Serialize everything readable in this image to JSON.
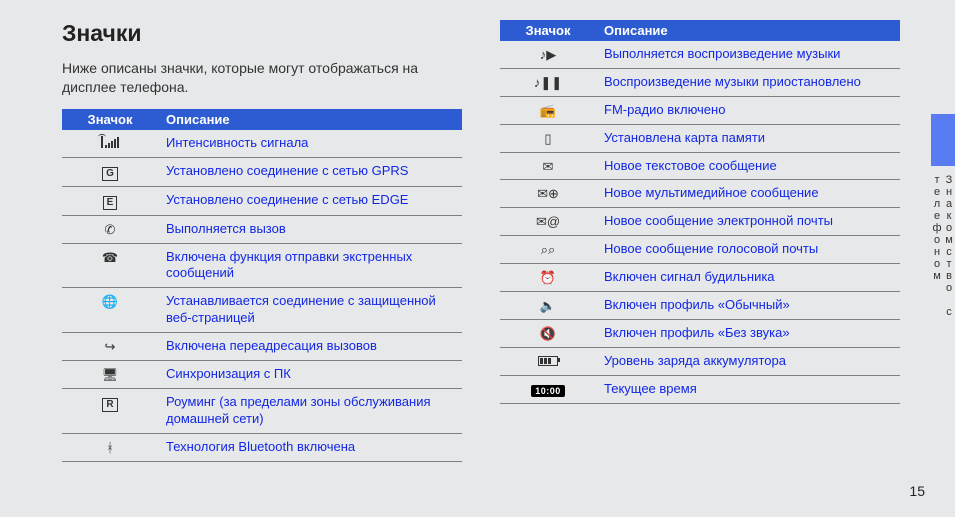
{
  "heading": "Значки",
  "intro": "Ниже описаны значки, которые могут отображаться на дисплее телефона.",
  "headers": {
    "icon": "Значок",
    "desc": "Описание"
  },
  "left_rows": [
    {
      "icon_name": "signal-strength-icon",
      "glyph": "signal",
      "desc": "Интенсивность сигнала"
    },
    {
      "icon_name": "gprs-icon",
      "glyph": "|G|",
      "desc": "Установлено соединение с сетью GPRS"
    },
    {
      "icon_name": "edge-icon",
      "glyph": "|E|",
      "desc": "Установлено соединение с сетью EDGE"
    },
    {
      "icon_name": "call-active-icon",
      "glyph": "✆",
      "desc": "Выполняется вызов"
    },
    {
      "icon_name": "sos-icon",
      "glyph": "☎",
      "desc": "Включена функция отправки экстренных сообщений"
    },
    {
      "icon_name": "secure-web-icon",
      "glyph": "🌐",
      "desc": "Устанавливается соединение с защищенной веб-страницей"
    },
    {
      "icon_name": "call-forward-icon",
      "glyph": "↪",
      "desc": "Включена переадресация вызовов"
    },
    {
      "icon_name": "pc-sync-icon",
      "glyph": "🖥",
      "desc": "Синхронизация с ПК"
    },
    {
      "icon_name": "roaming-icon",
      "glyph": "|R|",
      "desc": "Роуминг (за пределами зоны обслуживания домашней сети)"
    },
    {
      "icon_name": "bluetooth-icon",
      "glyph": "ᚼ",
      "desc": "Технология Bluetooth включена"
    }
  ],
  "right_rows": [
    {
      "icon_name": "music-play-icon",
      "glyph": "♪▶",
      "desc": "Выполняется воспроизведение музыки"
    },
    {
      "icon_name": "music-pause-icon",
      "glyph": "♪❚❚",
      "desc": "Воспроизведение музыки приостановлено"
    },
    {
      "icon_name": "fm-radio-icon",
      "glyph": "📻",
      "desc": "FM-радио включено"
    },
    {
      "icon_name": "memory-card-icon",
      "glyph": "▯",
      "desc": "Установлена карта памяти"
    },
    {
      "icon_name": "sms-icon",
      "glyph": "✉",
      "desc": "Новое текстовое сообщение"
    },
    {
      "icon_name": "mms-icon",
      "glyph": "✉⊕",
      "desc": "Новое мультимедийное сообщение"
    },
    {
      "icon_name": "email-icon",
      "glyph": "✉@",
      "desc": "Новое сообщение электронной почты"
    },
    {
      "icon_name": "voicemail-icon",
      "glyph": "⌕⌕",
      "desc": "Новое сообщение голосовой почты"
    },
    {
      "icon_name": "alarm-icon",
      "glyph": "⏰",
      "desc": "Включен сигнал будильника"
    },
    {
      "icon_name": "normal-profile-icon",
      "glyph": "🔈",
      "desc": "Включен профиль «Обычный»"
    },
    {
      "icon_name": "silent-profile-icon",
      "glyph": "🔇",
      "desc": "Включен профиль «Без звука»"
    },
    {
      "icon_name": "battery-icon",
      "glyph": "battery",
      "desc": "Уровень заряда аккумулятора"
    },
    {
      "icon_name": "clock-icon",
      "glyph": "10:00",
      "desc": "Текущее время"
    }
  ],
  "side_label": "Знакомство с телефоном",
  "page_number": "15"
}
